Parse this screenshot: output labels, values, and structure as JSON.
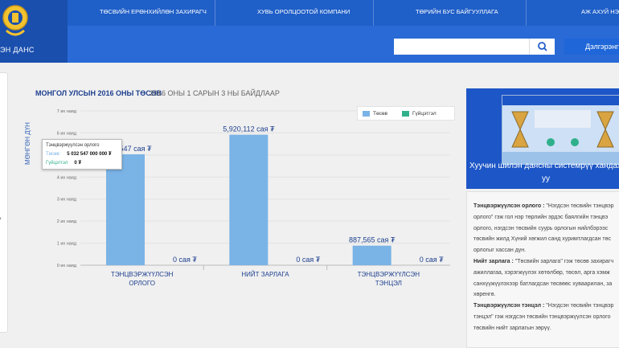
{
  "header": {
    "logo_text": "ЭН ДАНС",
    "nav": [
      "ТӨСВИЙН ЕРӨНХИЙЛӨН ЗАХИРАГЧ",
      "ХУВЬ ОРОЛЦООТОЙ КОМПАНИ",
      "ТӨРИЙН БУС БАЙГУУЛЛАГА",
      "АЖ АХУЙ НЭГЖ"
    ],
    "search_placeholder": "",
    "login_label": "Дэлгэрэнгүй"
  },
  "chart_header": {
    "title": "МОНГОЛ УЛСЫН 2016 ОНЫ ТӨСӨВ",
    "subtitle": "2016 ОНЫ 1 САРЫН 3 НЫ БАЙДЛААР"
  },
  "tooltip": {
    "title": "Тэнцвэржүүлсэн орлого",
    "row1_key": "Төсөв:",
    "row1_value": "5 032 547 000 000 ₮",
    "row2_key": "Гүйцэтгэл",
    "row2_value": "0 ₮"
  },
  "chart_data": {
    "type": "bar",
    "ylabel": "МӨНГӨН ДҮН",
    "ylim": [
      0,
      7
    ],
    "y_ticks": [
      "0 их наяд",
      "1 их наяд",
      "2 их наяд",
      "3 их наяд",
      "4 их наяд",
      "5 их наяд",
      "6 их наяд",
      "7 их наяд"
    ],
    "categories": [
      [
        "ТЭНЦВЭРЖҮҮЛСЭН",
        "ОРЛОГО"
      ],
      [
        "НИЙТ ЗАРЛАГА"
      ],
      [
        "ТЭНЦВЭРЖҮҮЛСЭН",
        "ТЭНЦЭЛ"
      ]
    ],
    "series": [
      {
        "name": "Төсөв",
        "color": "#7ab3e6",
        "values": [
          5.032547,
          5.920112,
          0.887565
        ],
        "labels": [
          "5,032,547 сая ₮",
          "5,920,112 сая ₮",
          "887,565 сая ₮"
        ]
      },
      {
        "name": "Гүйцэтгэл",
        "color": "#2fb08a",
        "values": [
          0,
          0,
          0
        ],
        "labels": [
          "0 сая ₮",
          "0 сая ₮",
          "0 сая ₮"
        ]
      }
    ],
    "legend_position": "top-right"
  },
  "banner": {
    "text_line1": "Хуучин шилэн дансны системрүү хандах бол",
    "text_line2": "уу"
  },
  "definitions": {
    "lines": [
      {
        "bold": "Тэнцвэржүүлсэн орлого :",
        "text": " \"Нэгдсэн төсвийн тэнцвэр"
      },
      {
        "bold": "",
        "text": "орлого\" гэж гол нэр төрлийн эрдэс баялгийн тэнцвэ"
      },
      {
        "bold": "",
        "text": "орлого, нэгдсэн төсвийн суурь орлогын нийлбэрээс"
      },
      {
        "bold": "",
        "text": "төсвийн жилд Хүний хөгжил санд хуримтлагдсан төс"
      },
      {
        "bold": "",
        "text": "орлогыг хассан дүн."
      },
      {
        "bold": "Нийт зарлага :",
        "text": " \"Төсвийн зарлага\" гэж төсөв захирагч"
      },
      {
        "bold": "",
        "text": "ажиллагаа, хэрэгжүүлэх хөтөлбөр, төсөл, арга хэмж"
      },
      {
        "bold": "",
        "text": "санхүүжүүлэхээр батлагдсан төсвөөс хуваарилан, за"
      },
      {
        "bold": "",
        "text": "хөренгө."
      },
      {
        "bold": "Тэнцвэржүүлсэн тэнцэл :",
        "text": " \"Нэгдсэн төсвийн тэнцвэр"
      },
      {
        "bold": "",
        "text": "тэнцэл\" гэж нэгдсэн төсвийн тэнцвэржүүлсэн орлого"
      },
      {
        "bold": "",
        "text": "төсвийн нийт зарлагын зөрүү."
      }
    ]
  }
}
